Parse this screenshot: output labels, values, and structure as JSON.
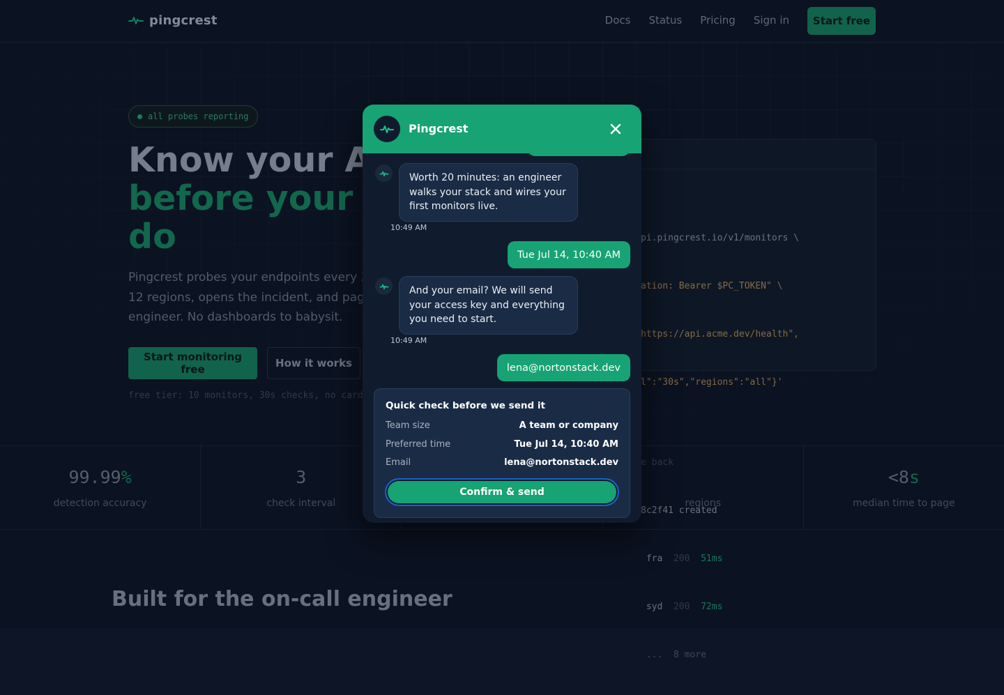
{
  "nav": {
    "brand": "pingcrest",
    "links": [
      "Docs",
      "Status",
      "Pricing",
      "Sign in"
    ],
    "cta": "Start free"
  },
  "hero": {
    "status_pill": "all probes reporting",
    "title_line1": "Know your API",
    "title_line2": "before your cu",
    "title_line3": "do",
    "subtitle": "Pingcrest probes your endpoints every 30 12 regions, opens the incident, and pages engineer. No dashboards to babysit.",
    "primary_button": "Start monitoring free",
    "secondary_button": "How it works",
    "free_tier_note": "free tier: 10 monitors, 30s checks, no card"
  },
  "code_card": {
    "lines": [
      {
        "text": "pi.pingcrest.io/v1/monitors \\",
        "style": "plain"
      },
      {
        "text": "ation: Bearer $PC_TOKEN\" \\",
        "style": "str"
      },
      {
        "text": "https://api.acme.dev/health\",",
        "style": "str"
      },
      {
        "text": "l\":\"30s\",\"regions\":\"all\"}'",
        "style": "str"
      },
      {
        "text": "",
        "style": "plain"
      },
      {
        "text": "e back",
        "style": "dim"
      },
      {
        "text": "8c2f41 created",
        "style": "plain"
      },
      {
        "text": " fra  200  51ms",
        "style": "probe"
      },
      {
        "text": " syd  200  72ms",
        "style": "probe"
      },
      {
        "text": " ...  8 more",
        "style": "dim"
      }
    ]
  },
  "stats": [
    {
      "value": "99.99",
      "accent": "%",
      "label": "detection accuracy"
    },
    {
      "value": "3",
      "accent": "",
      "label": "check interval"
    },
    {
      "value": "",
      "accent": "",
      "label": ""
    },
    {
      "value": "",
      "accent": "",
      "label": "regions"
    },
    {
      "value": "<8",
      "accent": "s",
      "label": "median time to page"
    }
  ],
  "section_title": "Built for the on-call engineer",
  "chat": {
    "title": "Pingcrest",
    "messages": [
      {
        "from": "bot",
        "text": "Worth 20 minutes: an engineer walks your stack and wires your first monitors live.",
        "time": "10:49 AM"
      },
      {
        "from": "user",
        "text": "Tue Jul 14, 10:40 AM"
      },
      {
        "from": "bot",
        "text": "And your email? We will send your access key and everything you need to start.",
        "time": "10:49 AM"
      },
      {
        "from": "user",
        "text": "lena@nortonstack.dev"
      }
    ],
    "confirm": {
      "title": "Quick check before we send it",
      "rows": [
        {
          "key": "Team size",
          "value": "A team or company"
        },
        {
          "key": "Preferred time",
          "value": "Tue Jul 14, 10:40 AM"
        },
        {
          "key": "Email",
          "value": "lena@nortonstack.dev"
        }
      ],
      "button": "Confirm & send"
    }
  },
  "colors": {
    "accent": "#17a373",
    "background": "#0d1526",
    "bubble": "#1a2b45"
  },
  "icons": {
    "brand": "pulse-icon",
    "close": "close-icon"
  }
}
